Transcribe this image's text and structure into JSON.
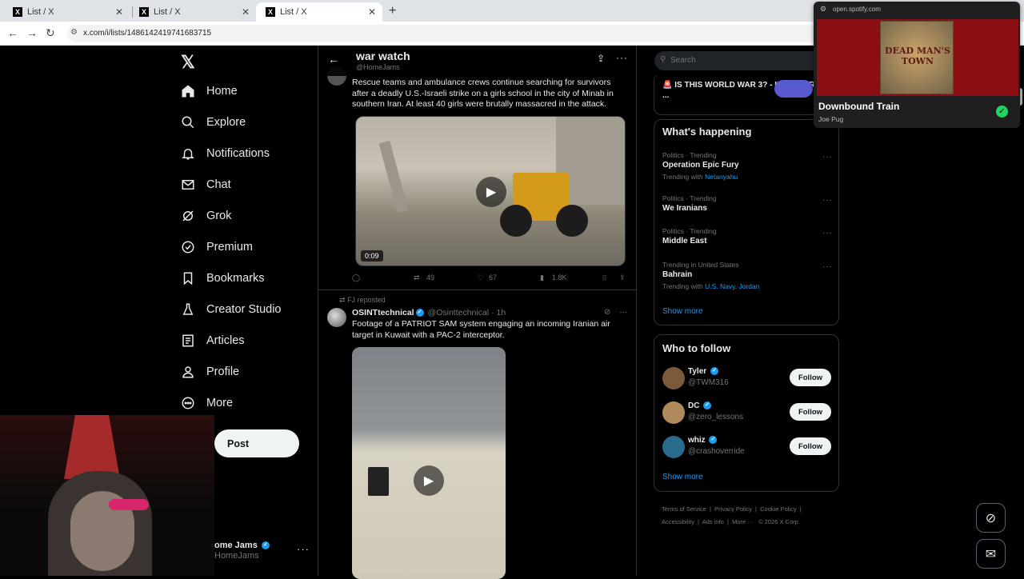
{
  "browser": {
    "tabs": [
      {
        "title": "List / X"
      },
      {
        "title": "List / X"
      },
      {
        "title": "List / X"
      }
    ],
    "url": "x.com/i/lists/1486142419741683715"
  },
  "sidebar": {
    "items": [
      {
        "label": "Home"
      },
      {
        "label": "Explore"
      },
      {
        "label": "Notifications"
      },
      {
        "label": "Chat"
      },
      {
        "label": "Grok"
      },
      {
        "label": "Premium"
      },
      {
        "label": "Bookmarks"
      },
      {
        "label": "Creator Studio"
      },
      {
        "label": "Articles"
      },
      {
        "label": "Profile"
      },
      {
        "label": "More"
      }
    ],
    "post_label": "Post",
    "account_name": "ome Jams",
    "account_handle": "HomeJams"
  },
  "header": {
    "title": "war watch",
    "subtitle": "@HomeJams"
  },
  "tweet1": {
    "text": "Rescue teams and ambulance crews continue searching for survivors after a deadly U.S.-Israeli strike on a girls school in the city of Minab in southern Iran. At least 40 girls were brutally massacred in the attack.",
    "duration": "0:09",
    "retweets": "49",
    "likes": "67",
    "views": "1.8K"
  },
  "tweet2": {
    "reposted_by": "FJ reposted",
    "author": "OSINTtechnical",
    "handle": "@Osinttechnical",
    "time": "· 1h",
    "text": "Footage of a PATRIOT SAM system engaging an incoming Iranian air target in Kuwait with a PAC-2 interceptor."
  },
  "right": {
    "search_placeholder": "Search",
    "live_text": "IS THIS WORLD WAR 3? - IRAN WAR LIVE ...",
    "whats_happening": "What's happening",
    "trends": [
      {
        "category": "Politics · Trending",
        "name": "Operation Epic Fury",
        "with_prefix": "Trending with",
        "with_links": "Netanyahu"
      },
      {
        "category": "Politics · Trending",
        "name": "We Iranians",
        "with_prefix": "",
        "with_links": ""
      },
      {
        "category": "Politics · Trending",
        "name": "Middle East",
        "with_prefix": "",
        "with_links": ""
      },
      {
        "category": "Trending in United States",
        "name": "Bahrain",
        "with_prefix": "Trending with",
        "with_links": "U.S. Navy, Jordan"
      }
    ],
    "show_more": "Show more",
    "who_to_follow": "Who to follow",
    "follows": [
      {
        "name": "Tyler",
        "handle": "@TWM316",
        "button": "Follow"
      },
      {
        "name": "DC",
        "handle": "@zero_lessons",
        "button": "Follow"
      },
      {
        "name": "whiz",
        "handle": "@crashoverride",
        "button": "Follow"
      }
    ],
    "footer": [
      "Terms of Service",
      "Privacy Policy",
      "Cookie Policy",
      "Accessibility",
      "Ads info",
      "More ···",
      "© 2026 X Corp."
    ]
  },
  "spotify": {
    "url": "open.spotify.com",
    "album_text": "DEAD MAN'S TOWN",
    "title": "Downbound Train",
    "artist": "Joe Pug"
  },
  "colors": {
    "accent": "#1d9bf0",
    "background": "#000000",
    "spotify_green": "#1ed760"
  }
}
